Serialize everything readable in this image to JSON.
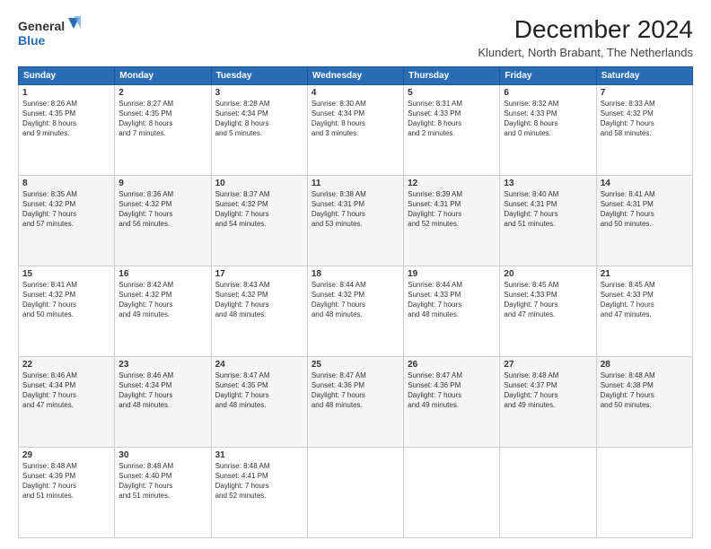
{
  "logo": {
    "line1": "General",
    "line2": "Blue"
  },
  "title": "December 2024",
  "subtitle": "Klundert, North Brabant, The Netherlands",
  "weekdays": [
    "Sunday",
    "Monday",
    "Tuesday",
    "Wednesday",
    "Thursday",
    "Friday",
    "Saturday"
  ],
  "weeks": [
    [
      {
        "day": "1",
        "info": "Sunrise: 8:26 AM\nSunset: 4:35 PM\nDaylight: 8 hours\nand 9 minutes."
      },
      {
        "day": "2",
        "info": "Sunrise: 8:27 AM\nSunset: 4:35 PM\nDaylight: 8 hours\nand 7 minutes."
      },
      {
        "day": "3",
        "info": "Sunrise: 8:28 AM\nSunset: 4:34 PM\nDaylight: 8 hours\nand 5 minutes."
      },
      {
        "day": "4",
        "info": "Sunrise: 8:30 AM\nSunset: 4:34 PM\nDaylight: 8 hours\nand 3 minutes."
      },
      {
        "day": "5",
        "info": "Sunrise: 8:31 AM\nSunset: 4:33 PM\nDaylight: 8 hours\nand 2 minutes."
      },
      {
        "day": "6",
        "info": "Sunrise: 8:32 AM\nSunset: 4:33 PM\nDaylight: 8 hours\nand 0 minutes."
      },
      {
        "day": "7",
        "info": "Sunrise: 8:33 AM\nSunset: 4:32 PM\nDaylight: 7 hours\nand 58 minutes."
      }
    ],
    [
      {
        "day": "8",
        "info": "Sunrise: 8:35 AM\nSunset: 4:32 PM\nDaylight: 7 hours\nand 57 minutes."
      },
      {
        "day": "9",
        "info": "Sunrise: 8:36 AM\nSunset: 4:32 PM\nDaylight: 7 hours\nand 56 minutes."
      },
      {
        "day": "10",
        "info": "Sunrise: 8:37 AM\nSunset: 4:32 PM\nDaylight: 7 hours\nand 54 minutes."
      },
      {
        "day": "11",
        "info": "Sunrise: 8:38 AM\nSunset: 4:31 PM\nDaylight: 7 hours\nand 53 minutes."
      },
      {
        "day": "12",
        "info": "Sunrise: 8:39 AM\nSunset: 4:31 PM\nDaylight: 7 hours\nand 52 minutes."
      },
      {
        "day": "13",
        "info": "Sunrise: 8:40 AM\nSunset: 4:31 PM\nDaylight: 7 hours\nand 51 minutes."
      },
      {
        "day": "14",
        "info": "Sunrise: 8:41 AM\nSunset: 4:31 PM\nDaylight: 7 hours\nand 50 minutes."
      }
    ],
    [
      {
        "day": "15",
        "info": "Sunrise: 8:41 AM\nSunset: 4:32 PM\nDaylight: 7 hours\nand 50 minutes."
      },
      {
        "day": "16",
        "info": "Sunrise: 8:42 AM\nSunset: 4:32 PM\nDaylight: 7 hours\nand 49 minutes."
      },
      {
        "day": "17",
        "info": "Sunrise: 8:43 AM\nSunset: 4:32 PM\nDaylight: 7 hours\nand 48 minutes."
      },
      {
        "day": "18",
        "info": "Sunrise: 8:44 AM\nSunset: 4:32 PM\nDaylight: 7 hours\nand 48 minutes."
      },
      {
        "day": "19",
        "info": "Sunrise: 8:44 AM\nSunset: 4:33 PM\nDaylight: 7 hours\nand 48 minutes."
      },
      {
        "day": "20",
        "info": "Sunrise: 8:45 AM\nSunset: 4:33 PM\nDaylight: 7 hours\nand 47 minutes."
      },
      {
        "day": "21",
        "info": "Sunrise: 8:45 AM\nSunset: 4:33 PM\nDaylight: 7 hours\nand 47 minutes."
      }
    ],
    [
      {
        "day": "22",
        "info": "Sunrise: 8:46 AM\nSunset: 4:34 PM\nDaylight: 7 hours\nand 47 minutes."
      },
      {
        "day": "23",
        "info": "Sunrise: 8:46 AM\nSunset: 4:34 PM\nDaylight: 7 hours\nand 48 minutes."
      },
      {
        "day": "24",
        "info": "Sunrise: 8:47 AM\nSunset: 4:35 PM\nDaylight: 7 hours\nand 48 minutes."
      },
      {
        "day": "25",
        "info": "Sunrise: 8:47 AM\nSunset: 4:36 PM\nDaylight: 7 hours\nand 48 minutes."
      },
      {
        "day": "26",
        "info": "Sunrise: 8:47 AM\nSunset: 4:36 PM\nDaylight: 7 hours\nand 49 minutes."
      },
      {
        "day": "27",
        "info": "Sunrise: 8:48 AM\nSunset: 4:37 PM\nDaylight: 7 hours\nand 49 minutes."
      },
      {
        "day": "28",
        "info": "Sunrise: 8:48 AM\nSunset: 4:38 PM\nDaylight: 7 hours\nand 50 minutes."
      }
    ],
    [
      {
        "day": "29",
        "info": "Sunrise: 8:48 AM\nSunset: 4:39 PM\nDaylight: 7 hours\nand 51 minutes."
      },
      {
        "day": "30",
        "info": "Sunrise: 8:48 AM\nSunset: 4:40 PM\nDaylight: 7 hours\nand 51 minutes."
      },
      {
        "day": "31",
        "info": "Sunrise: 8:48 AM\nSunset: 4:41 PM\nDaylight: 7 hours\nand 52 minutes."
      },
      {
        "day": "",
        "info": ""
      },
      {
        "day": "",
        "info": ""
      },
      {
        "day": "",
        "info": ""
      },
      {
        "day": "",
        "info": ""
      }
    ]
  ],
  "accent_color": "#2a6db5"
}
